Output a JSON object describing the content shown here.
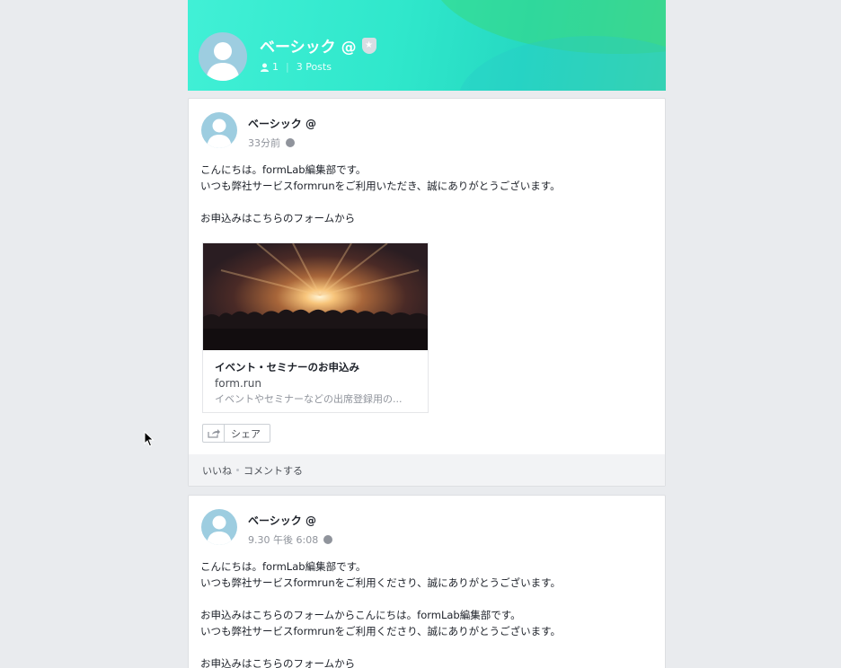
{
  "profile": {
    "name": "ベーシック @",
    "followers": "1",
    "posts": "3 Posts",
    "badge_icon": "shield-star-icon",
    "cover_colors": [
      "#41f0d6",
      "#26d9c2",
      "#3cd7a8"
    ]
  },
  "posts": [
    {
      "author": "ベーシック @",
      "time": "33分前",
      "body": "こんにちは。formLab編集部です。\nいつも弊社サービスformrunをご利用いただき、誠にありがとうございます。\n\nお申込みはこちらのフォームから",
      "link": {
        "title": "イベント・セミナーのお申込み",
        "domain": "form.run",
        "description": "イベントやセミナーなどの出席登録用の..."
      },
      "share_label": "シェア",
      "like_label": "いいね",
      "comment_label": "コメントする"
    },
    {
      "author": "ベーシック @",
      "time": "9.30 午後 6:08",
      "body": "こんにちは。formLab編集部です。\nいつも弊社サービスformrunをご利用くださり、誠にありがとうございます。\n\nお申込みはこちらのフォームからこんにちは。formLab編集部です。\nいつも弊社サービスformrunをご利用くださり、誠にありがとうございます。\n\nお申込みはこちらのフォームから"
    }
  ]
}
